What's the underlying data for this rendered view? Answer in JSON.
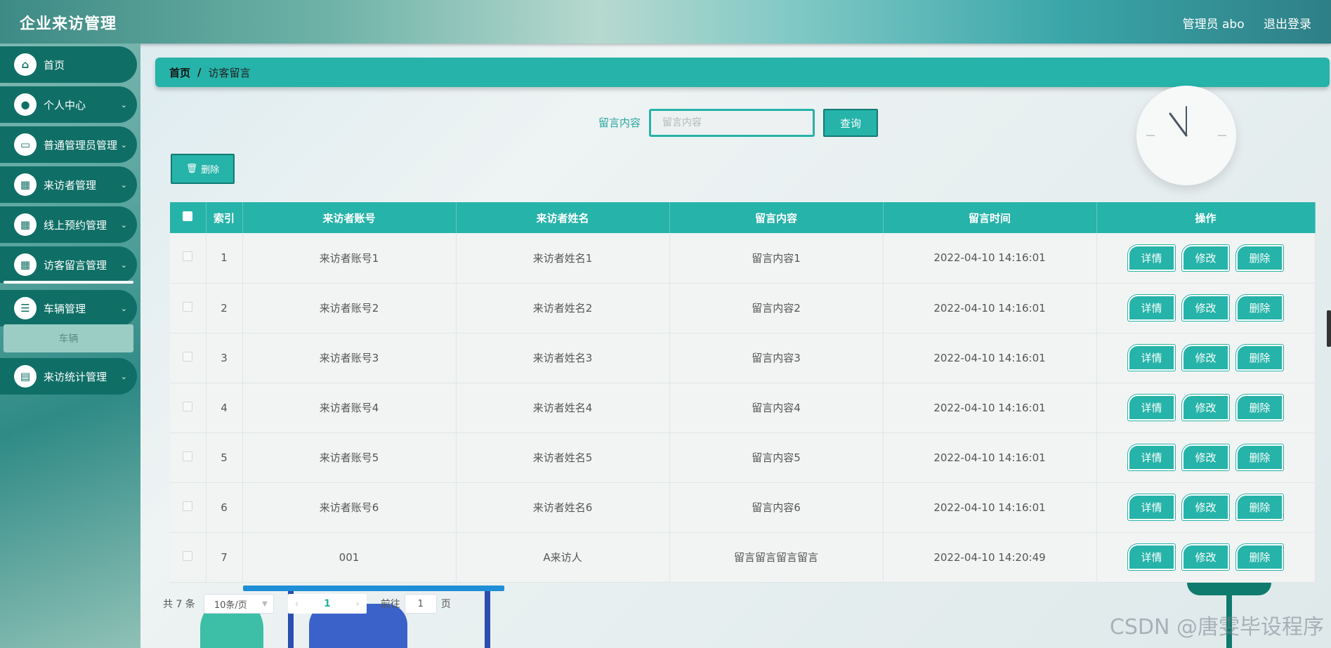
{
  "header": {
    "app_title": "企业来访管理",
    "user_label": "管理员 abo",
    "logout_label": "退出登录"
  },
  "sidebar": {
    "items": [
      {
        "label": "首页",
        "icon": "home-icon",
        "has_children": false
      },
      {
        "label": "个人中心",
        "icon": "person-icon",
        "has_children": true
      },
      {
        "label": "普通管理员管理",
        "icon": "monitor-icon",
        "has_children": true
      },
      {
        "label": "来访者管理",
        "icon": "grid-icon",
        "has_children": true
      },
      {
        "label": "线上预约管理",
        "icon": "grid-icon",
        "has_children": true
      },
      {
        "label": "访客留言管理",
        "icon": "grid-icon",
        "has_children": true
      },
      {
        "label": "车辆管理",
        "icon": "list-icon",
        "has_children": true
      },
      {
        "label": "来访统计管理",
        "icon": "clipboard-icon",
        "has_children": true
      }
    ],
    "submenu": {
      "label": "车辆"
    }
  },
  "breadcrumb": {
    "home": "首页",
    "separator": "/",
    "current": "访客留言"
  },
  "search": {
    "label": "留言内容",
    "placeholder": "留言内容",
    "value": "",
    "query_label": "查询"
  },
  "toolbar": {
    "delete_label": "删除"
  },
  "table": {
    "columns": [
      "",
      "索引",
      "来访者账号",
      "来访者姓名",
      "留言内容",
      "留言时间",
      "操作"
    ],
    "rows": [
      {
        "index": "1",
        "account": "来访者账号1",
        "name": "来访者姓名1",
        "content": "留言内容1",
        "time": "2022-04-10 14:16:01"
      },
      {
        "index": "2",
        "account": "来访者账号2",
        "name": "来访者姓名2",
        "content": "留言内容2",
        "time": "2022-04-10 14:16:01"
      },
      {
        "index": "3",
        "account": "来访者账号3",
        "name": "来访者姓名3",
        "content": "留言内容3",
        "time": "2022-04-10 14:16:01"
      },
      {
        "index": "4",
        "account": "来访者账号4",
        "name": "来访者姓名4",
        "content": "留言内容4",
        "time": "2022-04-10 14:16:01"
      },
      {
        "index": "5",
        "account": "来访者账号5",
        "name": "来访者姓名5",
        "content": "留言内容5",
        "time": "2022-04-10 14:16:01"
      },
      {
        "index": "6",
        "account": "来访者账号6",
        "name": "来访者姓名6",
        "content": "留言内容6",
        "time": "2022-04-10 14:16:01"
      },
      {
        "index": "7",
        "account": "001",
        "name": "A来访人",
        "content": "留言留言留言留言",
        "time": "2022-04-10 14:20:49"
      }
    ],
    "actions": {
      "detail": "详情",
      "edit": "修改",
      "delete": "删除"
    }
  },
  "pagination": {
    "total_text": "共 7 条",
    "page_size": "10条/页",
    "current_page": "1",
    "goto_label": "前往",
    "goto_value": "1",
    "goto_suffix": "页"
  },
  "watermark": "CSDN @唐雯毕设程序",
  "colors": {
    "accent": "#26b3a9",
    "sidebar_item": "#0f6f67"
  }
}
